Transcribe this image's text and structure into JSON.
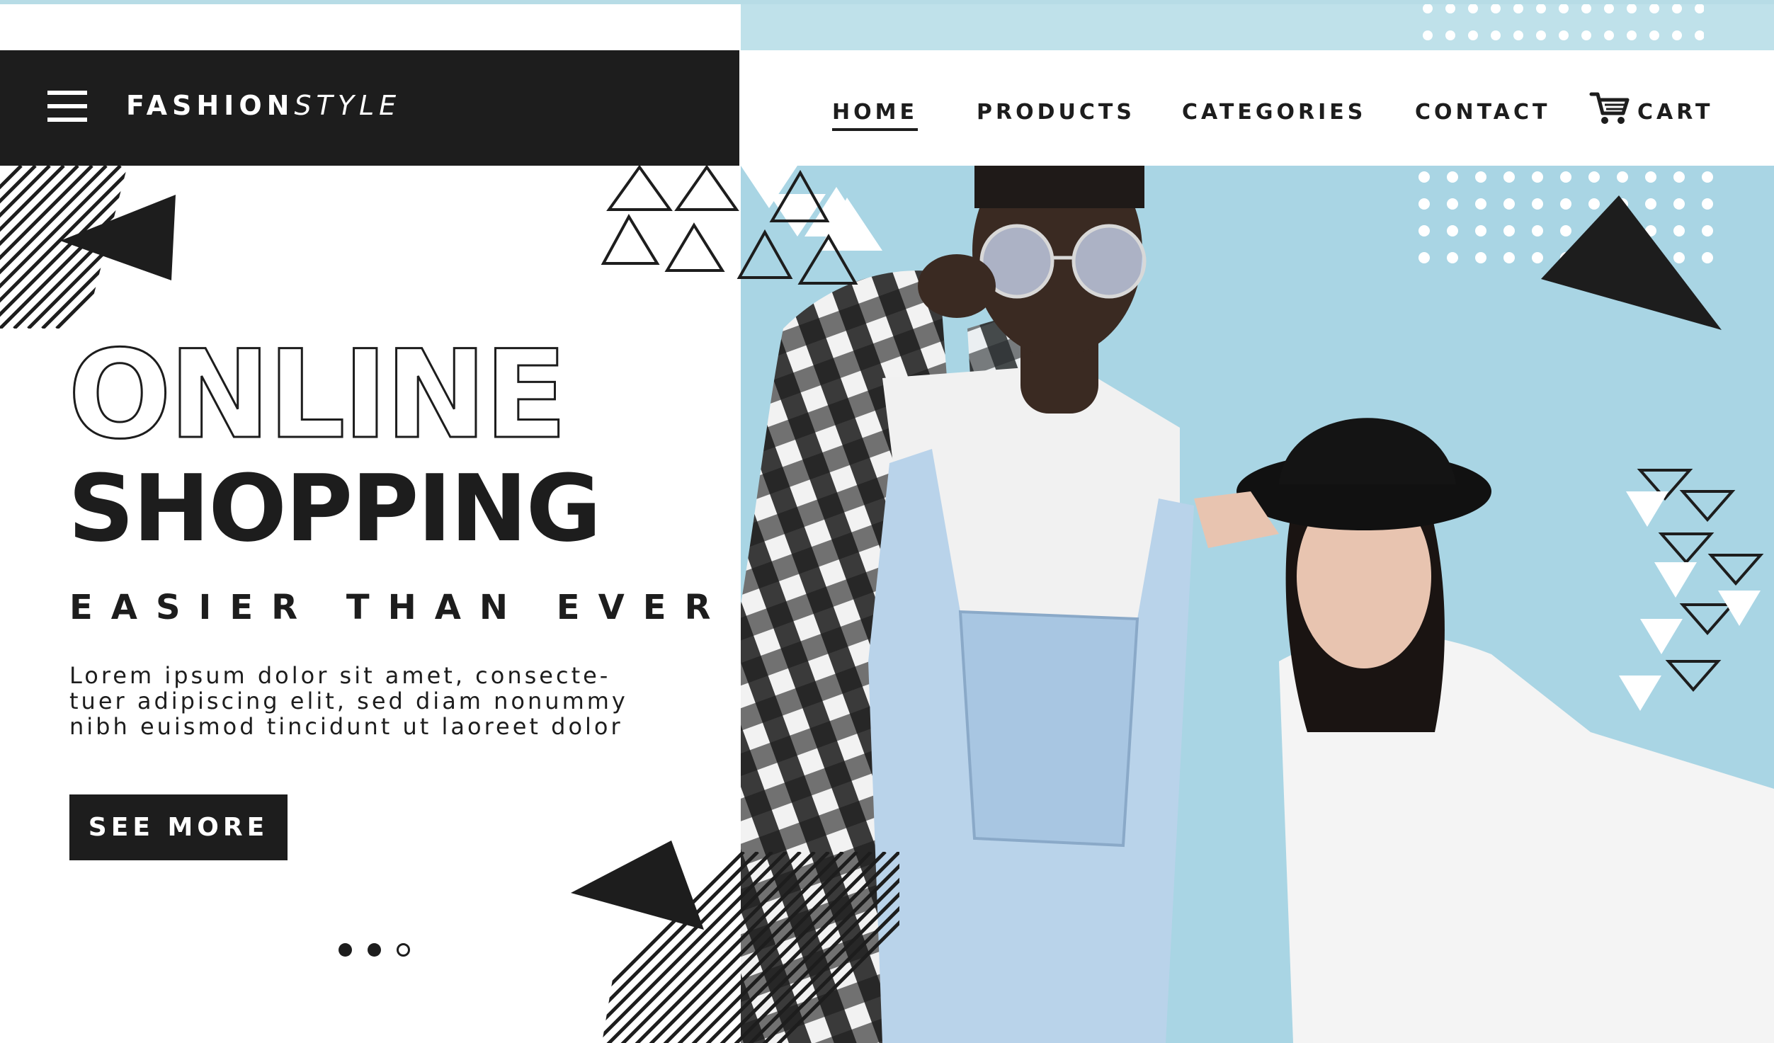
{
  "brand": {
    "name_part1": "FASHION",
    "name_part2": "STYLE"
  },
  "nav": {
    "items": [
      "HOME",
      "PRODUCTS",
      "CATEGORIES",
      "CONTACT"
    ],
    "active": "HOME",
    "cart_label": "CART"
  },
  "hero": {
    "headline_line1": "ONLINE",
    "headline_line2": "SHOPPING",
    "tagline": "EASIER THAN EVER",
    "body": "Lorem ipsum dolor sit amet, consecte-\ntuer adipiscing elit, sed diam nonummy\nnibh euismod tincidunt ut laoreet dolor",
    "cta_label": "SEE MORE"
  },
  "carousel": {
    "total_slides": 3,
    "indicator": "filled-filled-outline"
  },
  "colors": {
    "dark": "#1d1d1d",
    "accent_blue": "#a9d5e4",
    "light_blue": "#bfe1ea",
    "white": "#ffffff"
  },
  "icons": {
    "menu": "hamburger-menu-icon",
    "cart": "shopping-cart-icon"
  }
}
